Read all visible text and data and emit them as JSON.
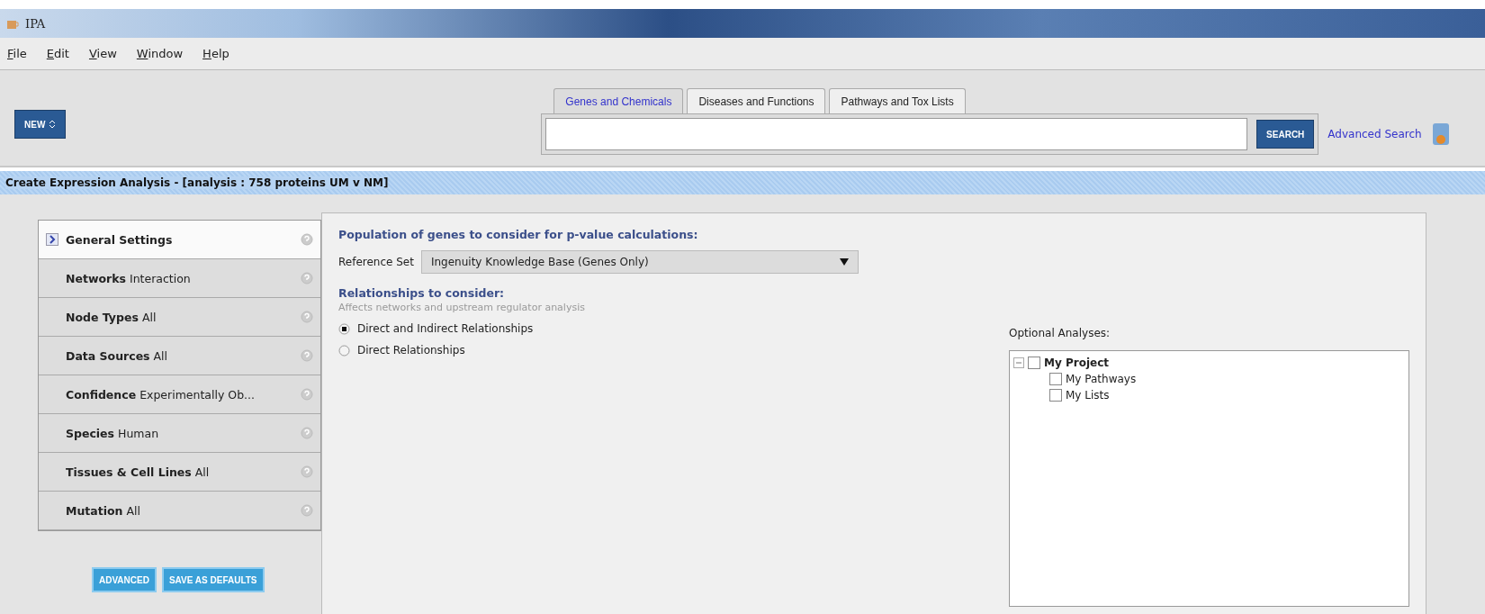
{
  "window": {
    "title": "IPA"
  },
  "menu": [
    {
      "label": "File"
    },
    {
      "label": "Edit"
    },
    {
      "label": "View"
    },
    {
      "label": "Window"
    },
    {
      "label": "Help"
    }
  ],
  "new_button": {
    "label": "NEW"
  },
  "search": {
    "tabs": [
      {
        "label": "Genes and Chemicals",
        "selected": true
      },
      {
        "label": "Diseases and Functions",
        "selected": false
      },
      {
        "label": "Pathways and Tox Lists",
        "selected": false
      }
    ],
    "button": "SEARCH",
    "link": "Advanced Search"
  },
  "panel_title": "Create Expression Analysis - [analysis : 758 proteins UM v NM]",
  "sidebar": {
    "items": [
      {
        "name": "General Settings",
        "selected": true
      },
      {
        "name": "Networks",
        "value": "Interaction",
        "selected": false
      },
      {
        "name": "Node Types",
        "value": "All",
        "selected": false
      },
      {
        "name": "Data Sources",
        "value": "All",
        "selected": false
      },
      {
        "name": "Confidence",
        "value": "Experimentally Ob...",
        "selected": false
      },
      {
        "name": "Species",
        "value": "Human",
        "selected": false
      },
      {
        "name": "Tissues & Cell Lines",
        "value": "All",
        "selected": false
      },
      {
        "name": "Mutation",
        "value": "All",
        "selected": false
      }
    ],
    "buttons": [
      {
        "label": "ADVANCED"
      },
      {
        "label": "SAVE AS DEFAULTS"
      }
    ]
  },
  "settings": {
    "population_heading": "Population of genes to consider for p-value calculations:",
    "reference_label": "Reference Set",
    "reference_value": "Ingenuity Knowledge Base (Genes Only)",
    "relationships_heading": "Relationships to consider:",
    "relationships_hint": "Affects networks and upstream regulator analysis",
    "radios": [
      {
        "label": "Direct and Indirect Relationships",
        "selected": true
      },
      {
        "label": "Direct Relationships",
        "selected": false
      }
    ],
    "optional_label": "Optional Analyses:",
    "tree": {
      "label": "My Project",
      "checked": false,
      "expanded": true,
      "children": [
        {
          "label": "My Pathways",
          "checked": false
        },
        {
          "label": "My Lists",
          "checked": false
        }
      ]
    }
  }
}
